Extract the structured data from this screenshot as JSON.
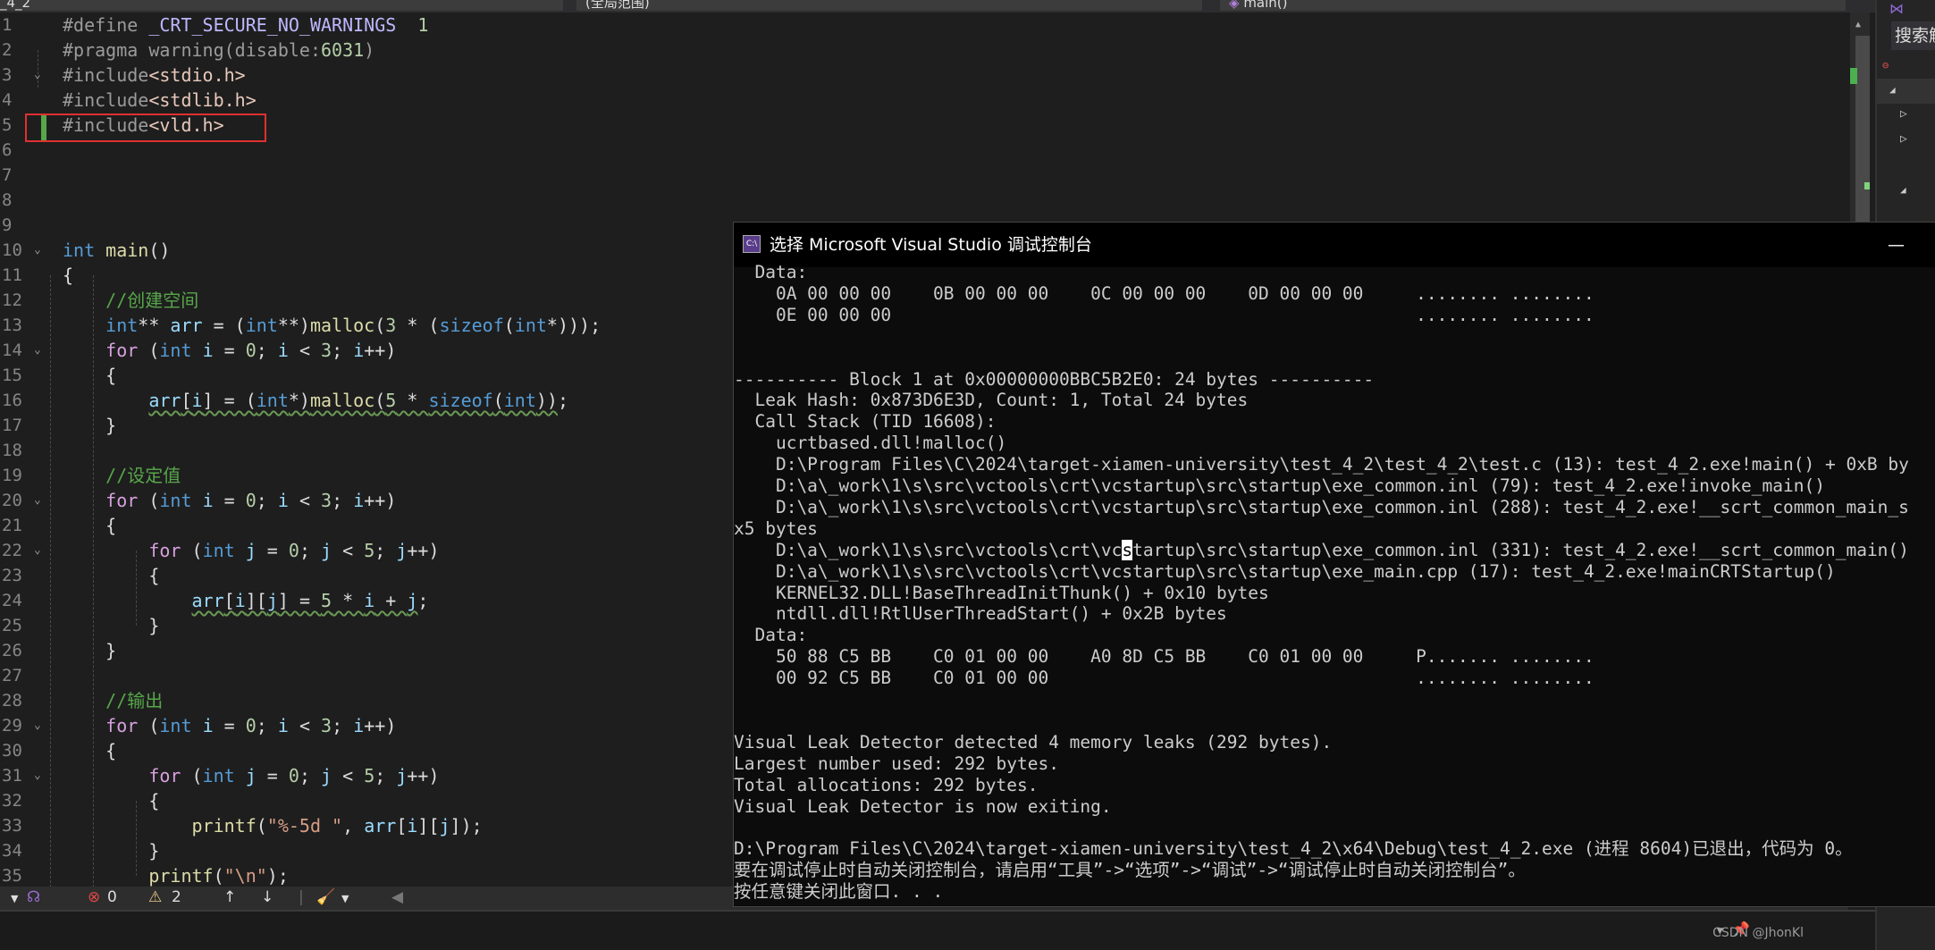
{
  "tabs": {
    "project": "_4_2",
    "scope": "(全局范围)",
    "member": "main()"
  },
  "editor": {
    "lines": [
      [
        [
          "#define ",
          "pp"
        ],
        [
          "_CRT_SECURE_NO_WARNINGS",
          "mac"
        ],
        [
          "  ",
          "p"
        ],
        [
          "1",
          "num"
        ]
      ],
      [
        [
          "#pragma warning(disable:",
          "pp"
        ],
        [
          "6031",
          "num"
        ],
        [
          ")",
          "pp"
        ]
      ],
      [
        [
          "#include",
          "pp"
        ],
        [
          "<stdio.h>",
          "inc"
        ]
      ],
      [
        [
          "#include",
          "pp"
        ],
        [
          "<stdlib.h>",
          "inc"
        ]
      ],
      [
        [
          "#include",
          "pp"
        ],
        [
          "<vld.h>",
          "inc"
        ]
      ],
      [],
      [],
      [],
      [],
      [
        [
          "int",
          "kw"
        ],
        [
          " ",
          "p"
        ],
        [
          "main",
          "fn"
        ],
        [
          "()",
          "p"
        ]
      ],
      [
        [
          "{",
          "p"
        ]
      ],
      [
        [
          "    //创建空间",
          "cm"
        ]
      ],
      [
        [
          "    ",
          "p"
        ],
        [
          "int",
          "kw"
        ],
        [
          "** ",
          "p"
        ],
        [
          "arr",
          "var"
        ],
        [
          " = (",
          "p"
        ],
        [
          "int",
          "kw"
        ],
        [
          "**)",
          "p"
        ],
        [
          "malloc",
          "fn"
        ],
        [
          "(",
          "p"
        ],
        [
          "3",
          "num"
        ],
        [
          " * (",
          "p"
        ],
        [
          "sizeof",
          "kw"
        ],
        [
          "(",
          "p"
        ],
        [
          "int",
          "kw"
        ],
        [
          "*)));",
          "p"
        ]
      ],
      [
        [
          "    ",
          "p"
        ],
        [
          "for",
          "ctl"
        ],
        [
          " (",
          "p"
        ],
        [
          "int",
          "kw"
        ],
        [
          " ",
          "p"
        ],
        [
          "i",
          "var"
        ],
        [
          " = ",
          "p"
        ],
        [
          "0",
          "num"
        ],
        [
          "; ",
          "p"
        ],
        [
          "i",
          "var"
        ],
        [
          " < ",
          "p"
        ],
        [
          "3",
          "num"
        ],
        [
          "; ",
          "p"
        ],
        [
          "i",
          "var"
        ],
        [
          "++)",
          "p"
        ]
      ],
      [
        [
          "    {",
          "p"
        ]
      ],
      [
        [
          "        ",
          "p"
        ],
        [
          "arr",
          "var",
          "sq"
        ],
        [
          "[",
          "p",
          "sq"
        ],
        [
          "i",
          "var",
          "sq"
        ],
        [
          "] = (",
          "p",
          "sq"
        ],
        [
          "int",
          "kw",
          "sq"
        ],
        [
          "*)",
          "p",
          "sq"
        ],
        [
          "malloc",
          "fn",
          "sq"
        ],
        [
          "(",
          "p",
          "sq"
        ],
        [
          "5",
          "num",
          "sq"
        ],
        [
          " * ",
          "p",
          "sq"
        ],
        [
          "sizeof",
          "kw",
          "sq"
        ],
        [
          "(",
          "p",
          "sq"
        ],
        [
          "int",
          "kw",
          "sq"
        ],
        [
          "))",
          "p",
          "sq"
        ],
        [
          ";",
          "p"
        ]
      ],
      [
        [
          "    }",
          "p"
        ]
      ],
      [],
      [
        [
          "    //设定值",
          "cm"
        ]
      ],
      [
        [
          "    ",
          "p"
        ],
        [
          "for",
          "ctl"
        ],
        [
          " (",
          "p"
        ],
        [
          "int",
          "kw"
        ],
        [
          " ",
          "p"
        ],
        [
          "i",
          "var"
        ],
        [
          " = ",
          "p"
        ],
        [
          "0",
          "num"
        ],
        [
          "; ",
          "p"
        ],
        [
          "i",
          "var"
        ],
        [
          " < ",
          "p"
        ],
        [
          "3",
          "num"
        ],
        [
          "; ",
          "p"
        ],
        [
          "i",
          "var"
        ],
        [
          "++)",
          "p"
        ]
      ],
      [
        [
          "    {",
          "p"
        ]
      ],
      [
        [
          "        ",
          "p"
        ],
        [
          "for",
          "ctl"
        ],
        [
          " (",
          "p"
        ],
        [
          "int",
          "kw"
        ],
        [
          " ",
          "p"
        ],
        [
          "j",
          "var"
        ],
        [
          " = ",
          "p"
        ],
        [
          "0",
          "num"
        ],
        [
          "; ",
          "p"
        ],
        [
          "j",
          "var"
        ],
        [
          " < ",
          "p"
        ],
        [
          "5",
          "num"
        ],
        [
          "; ",
          "p"
        ],
        [
          "j",
          "var"
        ],
        [
          "++)",
          "p"
        ]
      ],
      [
        [
          "        {",
          "p"
        ]
      ],
      [
        [
          "            ",
          "p"
        ],
        [
          "arr",
          "var",
          "sq"
        ],
        [
          "[",
          "p",
          "sq"
        ],
        [
          "i",
          "var",
          "sq"
        ],
        [
          "][",
          "p",
          "sq"
        ],
        [
          "j",
          "var",
          "sq"
        ],
        [
          "] = ",
          "p",
          "sq"
        ],
        [
          "5",
          "num",
          "sq"
        ],
        [
          " * ",
          "p",
          "sq"
        ],
        [
          "i",
          "var",
          "sq"
        ],
        [
          " + ",
          "p",
          "sq"
        ],
        [
          "j",
          "var",
          "sq"
        ],
        [
          ";",
          "p"
        ]
      ],
      [
        [
          "        }",
          "p"
        ]
      ],
      [
        [
          "    }",
          "p"
        ]
      ],
      [],
      [
        [
          "    //输出",
          "cm"
        ]
      ],
      [
        [
          "    ",
          "p"
        ],
        [
          "for",
          "ctl"
        ],
        [
          " (",
          "p"
        ],
        [
          "int",
          "kw"
        ],
        [
          " ",
          "p"
        ],
        [
          "i",
          "var"
        ],
        [
          " = ",
          "p"
        ],
        [
          "0",
          "num"
        ],
        [
          "; ",
          "p"
        ],
        [
          "i",
          "var"
        ],
        [
          " < ",
          "p"
        ],
        [
          "3",
          "num"
        ],
        [
          "; ",
          "p"
        ],
        [
          "i",
          "var"
        ],
        [
          "++)",
          "p"
        ]
      ],
      [
        [
          "    {",
          "p"
        ]
      ],
      [
        [
          "        ",
          "p"
        ],
        [
          "for",
          "ctl"
        ],
        [
          " (",
          "p"
        ],
        [
          "int",
          "kw"
        ],
        [
          " ",
          "p"
        ],
        [
          "j",
          "var"
        ],
        [
          " = ",
          "p"
        ],
        [
          "0",
          "num"
        ],
        [
          "; ",
          "p"
        ],
        [
          "j",
          "var"
        ],
        [
          " < ",
          "p"
        ],
        [
          "5",
          "num"
        ],
        [
          "; ",
          "p"
        ],
        [
          "j",
          "var"
        ],
        [
          "++)",
          "p"
        ]
      ],
      [
        [
          "        {",
          "p"
        ]
      ],
      [
        [
          "            ",
          "p"
        ],
        [
          "printf",
          "fn"
        ],
        [
          "(",
          "p"
        ],
        [
          "\"%-5d \"",
          "str"
        ],
        [
          ", ",
          "p"
        ],
        [
          "arr",
          "var"
        ],
        [
          "[",
          "p"
        ],
        [
          "i",
          "var"
        ],
        [
          "][",
          "p"
        ],
        [
          "j",
          "var"
        ],
        [
          "]);",
          "p"
        ]
      ],
      [
        [
          "        }",
          "p"
        ]
      ],
      [
        [
          "        ",
          "p"
        ],
        [
          "printf",
          "fn"
        ],
        [
          "(",
          "p"
        ],
        [
          "\"\\n\"",
          "str"
        ],
        [
          ");",
          "p"
        ]
      ]
    ],
    "fold_lines": [
      3,
      10,
      14,
      20,
      22,
      29,
      31
    ]
  },
  "status": {
    "errors": "0",
    "warnings": "2"
  },
  "side_panel": {
    "search_placeholder": "搜索解"
  },
  "console": {
    "title": "选择 Microsoft Visual Studio 调试控制台",
    "icon_label": "C:\\",
    "minimize": "—",
    "lines": [
      "  Data:",
      "    0A 00 00 00    0B 00 00 00    0C 00 00 00    0D 00 00 00     ........ ........",
      "    0E 00 00 00                                                  ........ ........",
      "",
      "",
      "---------- Block 1 at 0x00000000BBC5B2E0: 24 bytes ----------",
      "  Leak Hash: 0x873D6E3D, Count: 1, Total 24 bytes",
      "  Call Stack (TID 16608):",
      "    ucrtbased.dll!malloc()",
      "    D:\\Program Files\\C\\2024\\target-xiamen-university\\test_4_2\\test_4_2\\test.c (13): test_4_2.exe!main() + 0xB by",
      "    D:\\a\\_work\\1\\s\\src\\vctools\\crt\\vcstartup\\src\\startup\\exe_common.inl (79): test_4_2.exe!invoke_main()",
      "    D:\\a\\_work\\1\\s\\src\\vctools\\crt\\vcstartup\\src\\startup\\exe_common.inl (288): test_4_2.exe!__scrt_common_main_s",
      "x5 bytes",
      {
        "pre": "    D:\\a\\_work\\1\\s\\src\\vctools\\crt\\vc",
        "cur": "s",
        "post": "tartup\\src\\startup\\exe_common.inl (331): test_4_2.exe!__scrt_common_main()"
      },
      "    D:\\a\\_work\\1\\s\\src\\vctools\\crt\\vcstartup\\src\\startup\\exe_main.cpp (17): test_4_2.exe!mainCRTStartup()",
      "    KERNEL32.DLL!BaseThreadInitThunk() + 0x10 bytes",
      "    ntdll.dll!RtlUserThreadStart() + 0x2B bytes",
      "  Data:",
      "    50 88 C5 BB    C0 01 00 00    A0 8D C5 BB    C0 01 00 00     P....... ........",
      "    00 92 C5 BB    C0 01 00 00                                   ........ ........",
      "",
      "",
      "Visual Leak Detector detected 4 memory leaks (292 bytes).",
      "Largest number used: 292 bytes.",
      "Total allocations: 292 bytes.",
      "Visual Leak Detector is now exiting.",
      "",
      "D:\\Program Files\\C\\2024\\target-xiamen-university\\test_4_2\\x64\\Debug\\test_4_2.exe (进程 8604)已退出，代码为 0。",
      "要在调试停止时自动关闭控制台，请启用“工具”->“选项”->“调试”->“调试停止时自动关闭控制台”。",
      "按任意键关闭此窗口. . ."
    ]
  },
  "watermark": "CSDN @JhonKl"
}
